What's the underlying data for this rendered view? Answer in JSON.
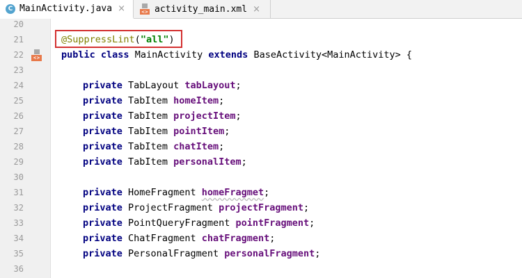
{
  "tabs": [
    {
      "label": "MainActivity.java",
      "icon": "java-class-icon",
      "icon_letter": "C",
      "active": true
    },
    {
      "label": "activity_main.xml",
      "icon": "xml-layout-icon",
      "active": false
    }
  ],
  "tab_close_glyph": "×",
  "xml_icon_glyph": "<>",
  "line_numbers": [
    "20",
    "21",
    "22",
    "23",
    "24",
    "25",
    "26",
    "27",
    "28",
    "29",
    "30",
    "31",
    "32",
    "33",
    "34",
    "35",
    "36"
  ],
  "code": {
    "annotation": "@SuppressLint",
    "annotation_arg_open": "(",
    "annotation_arg": "\"all\"",
    "annotation_arg_close": ")",
    "class_decl": {
      "kw_public": "public",
      "kw_class": "class",
      "name": "MainActivity",
      "kw_extends": "extends",
      "parent": "BaseActivity<MainActivity> {"
    },
    "kw_private": "private",
    "fields": [
      {
        "type": "TabLayout",
        "name": "tabLayout"
      },
      {
        "type": "TabItem",
        "name": "homeItem"
      },
      {
        "type": "TabItem",
        "name": "projectItem"
      },
      {
        "type": "TabItem",
        "name": "pointItem"
      },
      {
        "type": "TabItem",
        "name": "chatItem"
      },
      {
        "type": "TabItem",
        "name": "personalItem"
      },
      {
        "type": "HomeFragment",
        "name": "homeFragmet"
      },
      {
        "type": "ProjectFragment",
        "name": "projectFragment"
      },
      {
        "type": "PointQueryFragment",
        "name": "pointFragment"
      },
      {
        "type": "ChatFragment",
        "name": "chatFragment"
      },
      {
        "type": "PersonalFragment",
        "name": "personalFragment"
      }
    ],
    "semicolon": ";"
  },
  "colors": {
    "keyword": "#000080",
    "field": "#660e7a",
    "annotation": "#808000",
    "string": "#008000",
    "highlight_box": "#d32f2f"
  }
}
